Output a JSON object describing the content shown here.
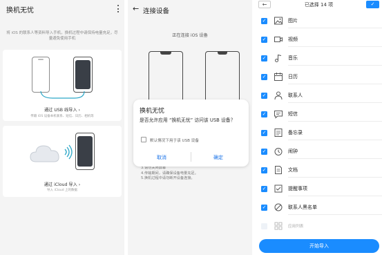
{
  "panel1": {
    "title": "换机无忧",
    "intro": "将 iOS 的联系人等资料导入手机，换机过程中请保持电量充足，尽量避免使用手机",
    "usb_card": {
      "title": "通过 USB 线导入 ›",
      "subtitle": "传输 iOS 设备本机联系、短信、日历、相机等"
    },
    "icloud_card": {
      "title": "通过 iCloud 导入 ›",
      "subtitle": "导入 iCloud 上的数据"
    }
  },
  "panel2": {
    "title": "连接设备",
    "connecting": "正在连接 iOS 设备",
    "hints": [
      "3.请勿关闭屏幕",
      "4.传输期间，请确保设备电量充足。",
      "5.换机过程中请勿断开设备连接。"
    ],
    "dialog": {
      "title": "换机无忧",
      "message": "是否允许应用 “换机无忧” 访问该 USB 设备？",
      "checkbox_label": "默认情况下用于该 USB 设备",
      "cancel": "取消",
      "ok": "确定"
    }
  },
  "panel3": {
    "back_glyph": "←",
    "title": "已选择 14 项",
    "done_glyph": "✓",
    "items": [
      {
        "label": "图片",
        "icon": "image-icon",
        "checked": true
      },
      {
        "label": "视频",
        "icon": "video-icon",
        "checked": true
      },
      {
        "label": "音乐",
        "icon": "music-icon",
        "checked": true
      },
      {
        "label": "日历",
        "icon": "calendar-icon",
        "checked": true
      },
      {
        "label": "联系人",
        "icon": "contact-icon",
        "checked": true
      },
      {
        "label": "短信",
        "icon": "message-icon",
        "checked": true
      },
      {
        "label": "备忘录",
        "icon": "memo-icon",
        "checked": true
      },
      {
        "label": "闹钟",
        "icon": "alarm-icon",
        "checked": true
      },
      {
        "label": "文档",
        "icon": "document-icon",
        "checked": true
      },
      {
        "label": "提醒事项",
        "icon": "reminder-icon",
        "checked": true
      },
      {
        "label": "联系人黑名单",
        "icon": "blocklist-icon",
        "checked": true
      },
      {
        "label": "应用列表",
        "icon": "app-list-icon",
        "checked": false
      }
    ],
    "start_button": "开始导入"
  },
  "colors": {
    "accent": "#1a8cff",
    "panel_bg": "#f4f4f4",
    "dark_screen": "#3a3f47",
    "link": "#1a73e8"
  }
}
